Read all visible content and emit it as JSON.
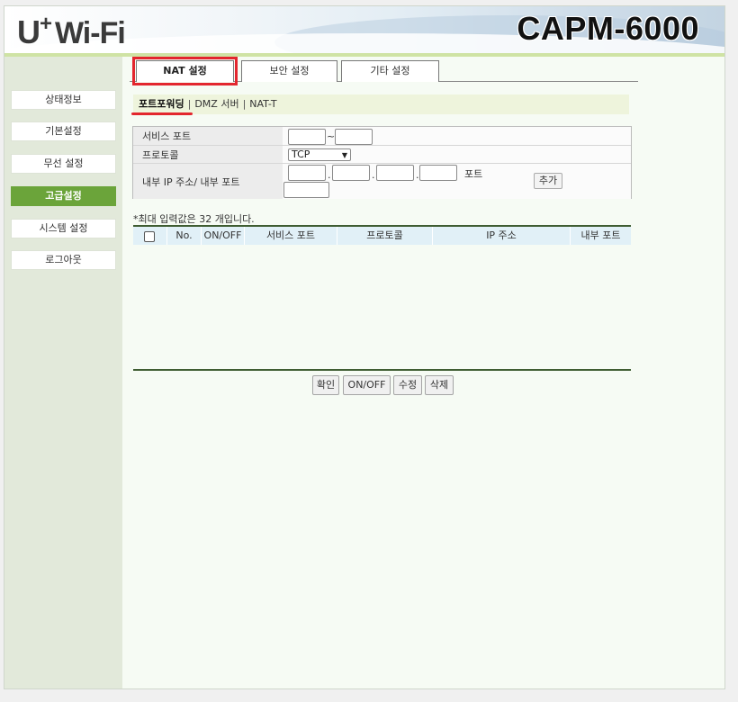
{
  "header": {
    "logo_u": "U",
    "logo_plus": "+",
    "logo_wifi": "Wi-Fi",
    "model": "CAPM-6000"
  },
  "sidebar": {
    "items": [
      {
        "label": "상태정보"
      },
      {
        "label": "기본설정"
      },
      {
        "label": "무선 설정"
      },
      {
        "label": "고급설정"
      },
      {
        "label": "시스템 설정"
      },
      {
        "label": "로그아웃"
      }
    ]
  },
  "tabs": [
    {
      "label": "NAT 설정"
    },
    {
      "label": "보안 설정"
    },
    {
      "label": "기타 설정"
    }
  ],
  "subnav": {
    "items": [
      {
        "label": "포트포워딩"
      },
      {
        "label": "DMZ 서버"
      },
      {
        "label": "NAT-T"
      }
    ],
    "separator": "|"
  },
  "form": {
    "service_port_label": "서비스 포트",
    "range_sep": "~",
    "protocol_label": "프로토콜",
    "protocol_value": "TCP",
    "internal_label": "내부 IP 주소/ 내부 포트",
    "dot": ".",
    "port_suffix": "포트",
    "add_button": "추가"
  },
  "note": "*최대 입력값은 32 개입니다.",
  "table": {
    "headers": [
      "No.",
      "ON/OFF",
      "서비스 포트",
      "프로토콜",
      "IP 주소",
      "내부 포트"
    ]
  },
  "actions": {
    "confirm": "확인",
    "onoff": "ON/OFF",
    "edit": "수정",
    "delete": "삭제"
  },
  "colors": {
    "accent_green": "#6ba43a",
    "highlight_red": "#e3262e"
  }
}
